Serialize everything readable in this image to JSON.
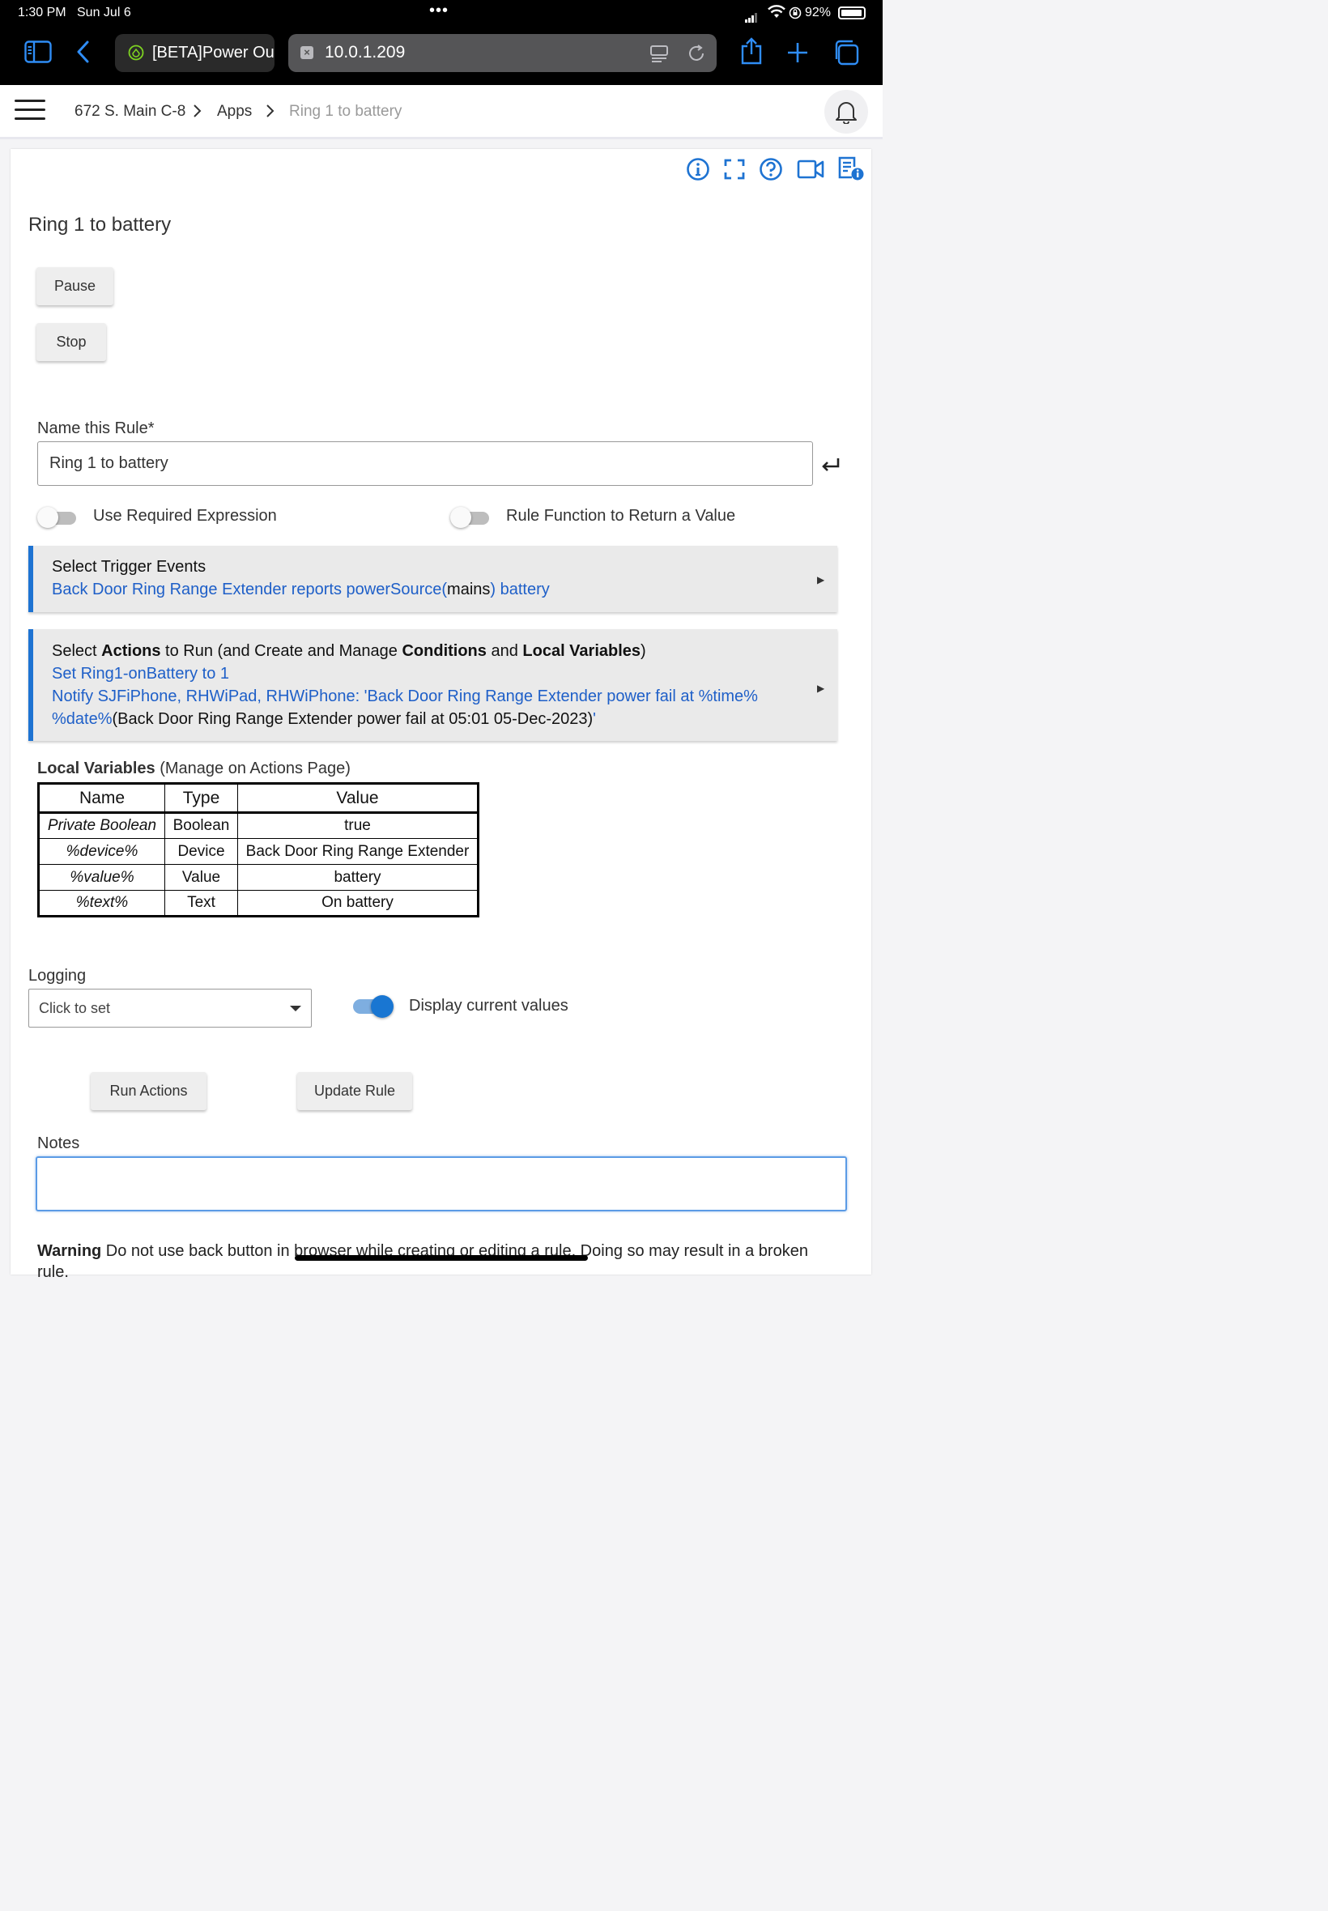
{
  "status_bar": {
    "time": "1:30 PM",
    "date": "Sun Jul 6",
    "battery_pct": "92%"
  },
  "browser": {
    "inactive_tab_label": "[BETA]Power Ou",
    "address": "10.0.1.209"
  },
  "header": {
    "crumbs": [
      "672 S. Main C-8",
      "Apps",
      "Ring 1 to battery"
    ]
  },
  "app": {
    "title": "Ring 1 to battery",
    "pause_label": "Pause",
    "stop_label": "Stop",
    "name_label": "Name this Rule*",
    "name_value": "Ring 1 to battery",
    "toggle_required_expression": "Use Required Expression",
    "toggle_return_value": "Rule Function to Return a Value",
    "triggers": {
      "title": "Select Trigger Events",
      "line_blue_1": "Back Door Ring Range Extender reports powerSource(",
      "line_black": "mains",
      "line_blue_2": ") battery"
    },
    "actions": {
      "title_1": "Select ",
      "title_b1": "Actions",
      "title_2": " to Run (and Create and Manage ",
      "title_b2": "Conditions",
      "title_3": " and ",
      "title_b3": "Local Variables",
      "title_4": ")",
      "line1": "Set Ring1-onBattery to 1",
      "line2": "Notify SJFiPhone, RHWiPad, RHWiPhone: 'Back Door Ring Range Extender power fail at %time%",
      "line3_blue": "%date%",
      "line3_black": "(Back Door Ring Range Extender power fail at 05:01 05-Dec-2023)",
      "line3_tail": "'"
    },
    "local_vars": {
      "title_bold": "Local Variables",
      "title_rest": " (Manage on Actions Page)",
      "headers": [
        "Name",
        "Type",
        "Value"
      ],
      "rows": [
        [
          "Private Boolean",
          "Boolean",
          "true"
        ],
        [
          "%device%",
          "Device",
          "Back Door Ring Range Extender"
        ],
        [
          "%value%",
          "Value",
          "battery"
        ],
        [
          "%text%",
          "Text",
          "On battery"
        ]
      ]
    },
    "logging_label": "Logging",
    "logging_value": "Click to set",
    "display_current_values": "Display current values",
    "run_actions_label": "Run Actions",
    "update_rule_label": "Update Rule",
    "notes_label": "Notes",
    "warning_bold": "Warning",
    "warning_text": " Do not use back button in browser while creating or editing a rule. Doing so may result in a broken rule."
  },
  "colors": {
    "accent": "#1e73d2",
    "link": "#1e5fc8",
    "toggle_on": "#1976d2"
  },
  "icons": [
    "sidebar-icon",
    "back-chevron-icon",
    "share-icon",
    "plus-icon",
    "tabs-icon",
    "bell-icon",
    "info-icon",
    "fullscreen-icon",
    "help-icon",
    "video-icon",
    "doc-info-icon",
    "enter-icon"
  ]
}
